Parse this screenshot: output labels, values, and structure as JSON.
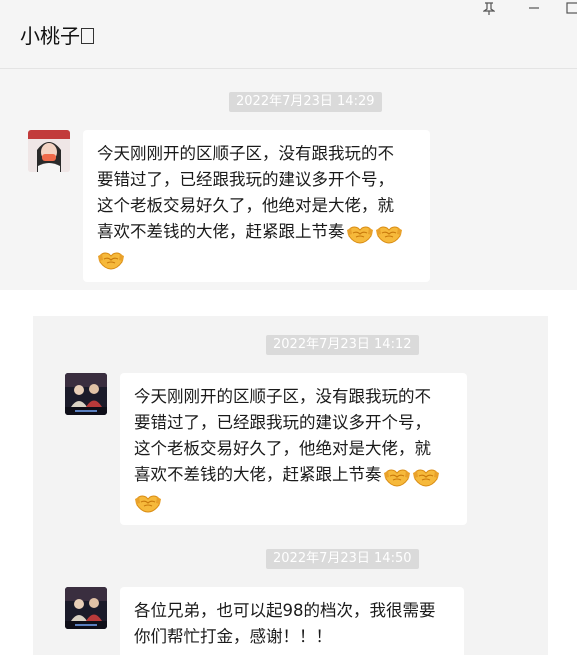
{
  "window": {
    "title": "小桃子",
    "pin_icon": "pin-icon",
    "minimize_icon": "minimize-icon",
    "maximize_icon": "maximize-icon"
  },
  "top_chat": {
    "timestamp": "2022年7月23日 14:29",
    "message": {
      "lines": [
        "今天刚刚开的区顺子区，没有跟我玩的不",
        "要错过了，已经跟我玩的建议多开个号，",
        "这个老板交易好久了，他绝对是大佬，就",
        "喜欢不差钱的大佬，赶紧跟上节奏"
      ],
      "emoji": "handshake-emoji"
    }
  },
  "lower_chat": {
    "messages": [
      {
        "timestamp": "2022年7月23日 14:12",
        "lines": [
          "今天刚刚开的区顺子区，没有跟我玩的不",
          "要错过了，已经跟我玩的建议多开个号，",
          "这个老板交易好久了，他绝对是大佬，就",
          "喜欢不差钱的大佬，赶紧跟上节奏"
        ],
        "emoji": "handshake-emoji"
      },
      {
        "timestamp": "2022年7月23日 14:50",
        "lines": [
          "各位兄弟，也可以起98的档次，我很需要",
          "你们帮忙打金，感谢！！！"
        ]
      }
    ]
  },
  "colors": {
    "chat_background": "#f5f5f5",
    "bubble": "#ffffff",
    "timestamp_pill": "#dadada",
    "emoji": "#f5b43c"
  }
}
